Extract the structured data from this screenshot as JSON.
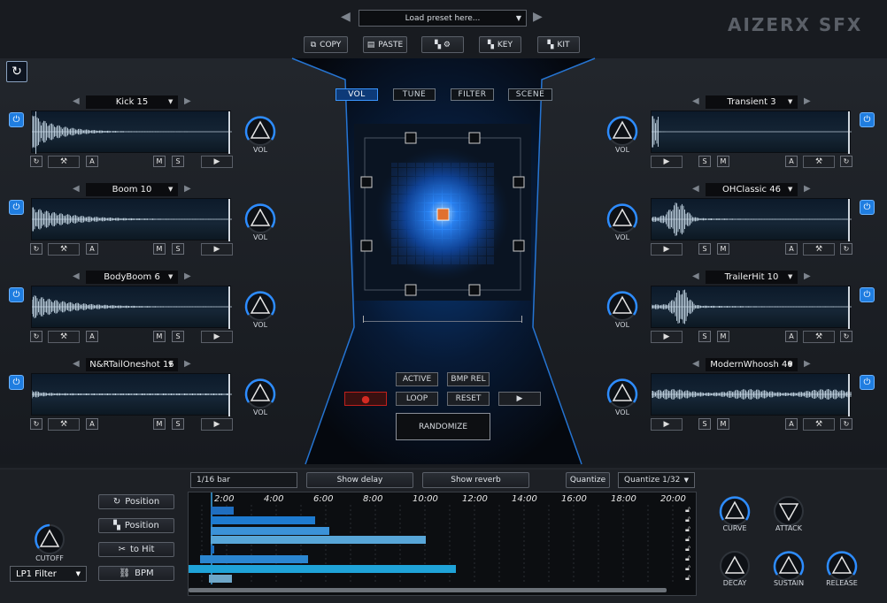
{
  "header": {
    "preset_placeholder": "Load preset here...",
    "brand": "AIZERX SFX",
    "toolbar": {
      "copy": "COPY",
      "paste": "PASTE",
      "key": "KEY",
      "kit": "KIT"
    }
  },
  "center": {
    "tabs": [
      "VOL",
      "TUNE",
      "FILTER",
      "SCENE"
    ],
    "active_tab": "VOL",
    "buttons": {
      "active": "ACTIVE",
      "bmp_rel": "BMP REL",
      "loop": "LOOP",
      "reset": "RESET",
      "randomize": "RANDOMIZE"
    }
  },
  "slots_left": [
    {
      "name": "Kick 15",
      "vol_label": "VOL"
    },
    {
      "name": "Boom 10",
      "vol_label": "VOL"
    },
    {
      "name": "BodyBoom 6",
      "vol_label": "VOL"
    },
    {
      "name": "N&RTailOneshot 15",
      "vol_label": "VOL"
    }
  ],
  "slots_right": [
    {
      "name": "Transient 3",
      "vol_label": "VOL"
    },
    {
      "name": "OHClassic 46",
      "vol_label": "VOL"
    },
    {
      "name": "TrailerHit 10",
      "vol_label": "VOL"
    },
    {
      "name": "ModernWhoosh 40",
      "vol_label": "VOL"
    }
  ],
  "slot_labels": {
    "a": "A",
    "m": "M",
    "s": "S"
  },
  "bottom": {
    "cutoff_label": "CUTOFF",
    "filter_select": "LP1 Filter",
    "side_buttons": [
      "Position",
      "Position",
      "to Hit",
      "BPM"
    ],
    "length_field": "1/16 bar",
    "show_delay": "Show delay",
    "show_reverb": "Show reverb",
    "quantize": "Quantize",
    "quantize_select": "Quantize 1/32",
    "ticks": [
      "2:00",
      "4:00",
      "6:00",
      "8:00",
      "10:00",
      "12:00",
      "14:00",
      "16:00",
      "18:00",
      "20:00"
    ],
    "envelope": [
      "CURVE",
      "ATTACK",
      "DECAY",
      "SUSTAIN",
      "RELEASE"
    ]
  },
  "colors": {
    "accent": "#1f7de0",
    "record": "#c0201c",
    "xy_handle": "#e07030"
  }
}
